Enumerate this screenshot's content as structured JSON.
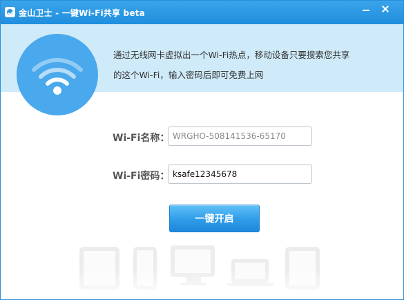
{
  "window": {
    "title": "金山卫士 - 一键Wi-Fi共享 beta",
    "app_icon": "kingsoft-shield-icon",
    "minimize_icon": "minimize-icon",
    "close_icon": "close-icon"
  },
  "header": {
    "icon": "wifi-icon",
    "description_line1": "通过无线网卡虚拟出一个Wi-Fi热点，移动设备只要搜索您共享",
    "description_line2": "的这个Wi-Fi，输入密码后即可免费上网"
  },
  "form": {
    "name_label": "Wi-Fi名称：",
    "name_value": "WRGHO-508141536-65170",
    "password_label": "Wi-Fi密码：",
    "password_value": "ksafe12345678",
    "start_button": "一键开启"
  },
  "devices": [
    "tablet-icon",
    "phone-icon",
    "monitor-icon",
    "laptop-icon",
    "tablet-icon"
  ],
  "colors": {
    "titlebar": "#1f8ede",
    "header_band": "#cfeaf8",
    "wifi_circle": "#4aa8ec",
    "button": "#2f9ce8"
  }
}
